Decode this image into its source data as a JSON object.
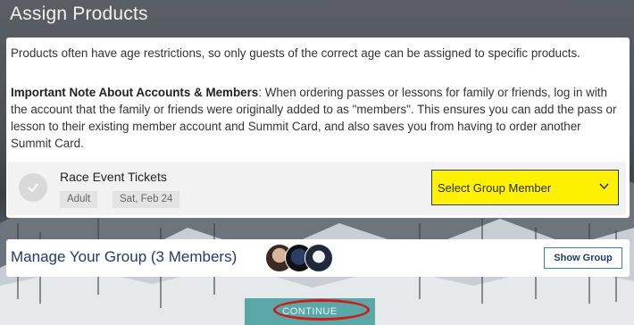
{
  "page": {
    "title": "Assign Products"
  },
  "info": {
    "paragraph1": "Products often have age restrictions, so only guests of the correct age can be assigned to specific products.",
    "note_heading": "Important Note About Accounts & Members",
    "note_body": ": When ordering passes or lessons for family or friends, log in with the account that the family or friends were originally added to as \"members\". This ensures you can add the pass or lesson to their existing member account and Summit Card, and also saves you from having to order another Summit Card."
  },
  "product": {
    "name": "Race Event Tickets",
    "tags": [
      "Adult",
      "Sat, Feb 24"
    ],
    "member_select": {
      "selected": "Select Group Member",
      "highlight_color": "#fff200"
    }
  },
  "group": {
    "title": "Manage Your Group (3 Members)",
    "show_group_label": "Show Group"
  },
  "footer": {
    "continue_label": "CONTINUE",
    "annotation_color": "#d11a1a"
  },
  "colors": {
    "navy": "#1f3b6b",
    "teal": "#5aa7a7"
  }
}
